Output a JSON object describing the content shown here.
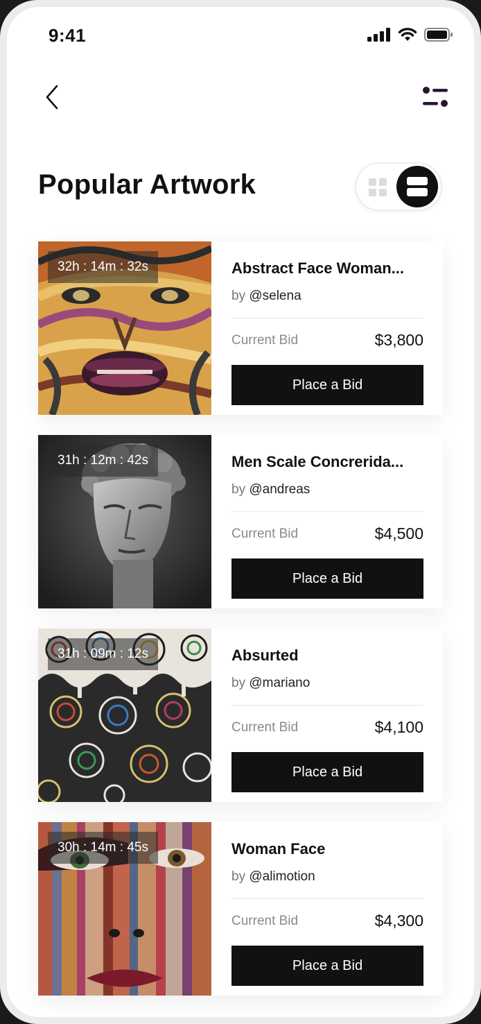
{
  "status_bar": {
    "time": "9:41"
  },
  "header": {
    "title": "Popular Artwork"
  },
  "artworks": [
    {
      "timer": "32h : 14m : 32s",
      "title": "Abstract Face Woman...",
      "by": "by",
      "artist": "@selena",
      "bid_label": "Current Bid",
      "bid": "$3,800",
      "button": "Place a Bid"
    },
    {
      "timer": "31h : 12m : 42s",
      "title": "Men Scale Concrerida...",
      "by": "by",
      "artist": "@andreas",
      "bid_label": "Current Bid",
      "bid": "$4,500",
      "button": "Place a Bid"
    },
    {
      "timer": "31h : 09m : 12s",
      "title": "Absurted",
      "by": "by",
      "artist": "@mariano",
      "bid_label": "Current Bid",
      "bid": "$4,100",
      "button": "Place a Bid"
    },
    {
      "timer": "30h : 14m : 45s",
      "title": "Woman Face",
      "by": "by",
      "artist": "@alimotion",
      "bid_label": "Current Bid",
      "bid": "$4,300",
      "button": "Place a Bid"
    }
  ],
  "icons": {
    "back": "chevron-left-icon",
    "filter": "filter-sliders-icon",
    "grid_view": "grid-icon",
    "list_view": "list-icon"
  },
  "colors": {
    "accent": "#111111",
    "filter_icon": "#2a1433"
  }
}
